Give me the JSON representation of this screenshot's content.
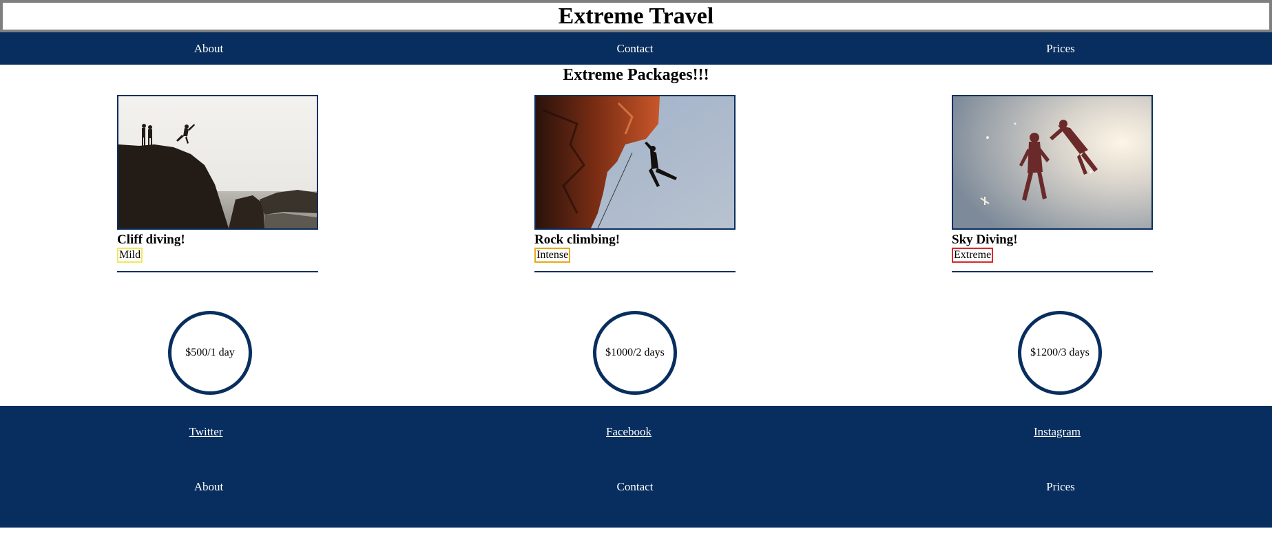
{
  "site": {
    "title": "Extreme Travel"
  },
  "nav": {
    "items": [
      "About",
      "Contact",
      "Prices"
    ]
  },
  "main": {
    "heading": "Extreme Packages!!!"
  },
  "packages": [
    {
      "name": "Cliff diving!",
      "intensity": "Mild",
      "intensity_color": "#f2e85c",
      "price": "$500/1 day",
      "photo": "cliff-diving-photo"
    },
    {
      "name": "Rock climbing!",
      "intensity": "Intense",
      "intensity_color": "#e6a817",
      "price": "$1000/2 days",
      "photo": "rock-climbing-photo"
    },
    {
      "name": "Sky Diving!",
      "intensity": "Extreme",
      "intensity_color": "#d42a2a",
      "price": "$1200/3 days",
      "photo": "sky-diving-photo"
    }
  ],
  "footer": {
    "social": [
      "Twitter",
      "Facebook",
      "Instagram"
    ],
    "nav": [
      "About",
      "Contact",
      "Prices"
    ]
  },
  "colors": {
    "brand_navy": "#082e5f",
    "title_border": "#7f7f7f"
  }
}
